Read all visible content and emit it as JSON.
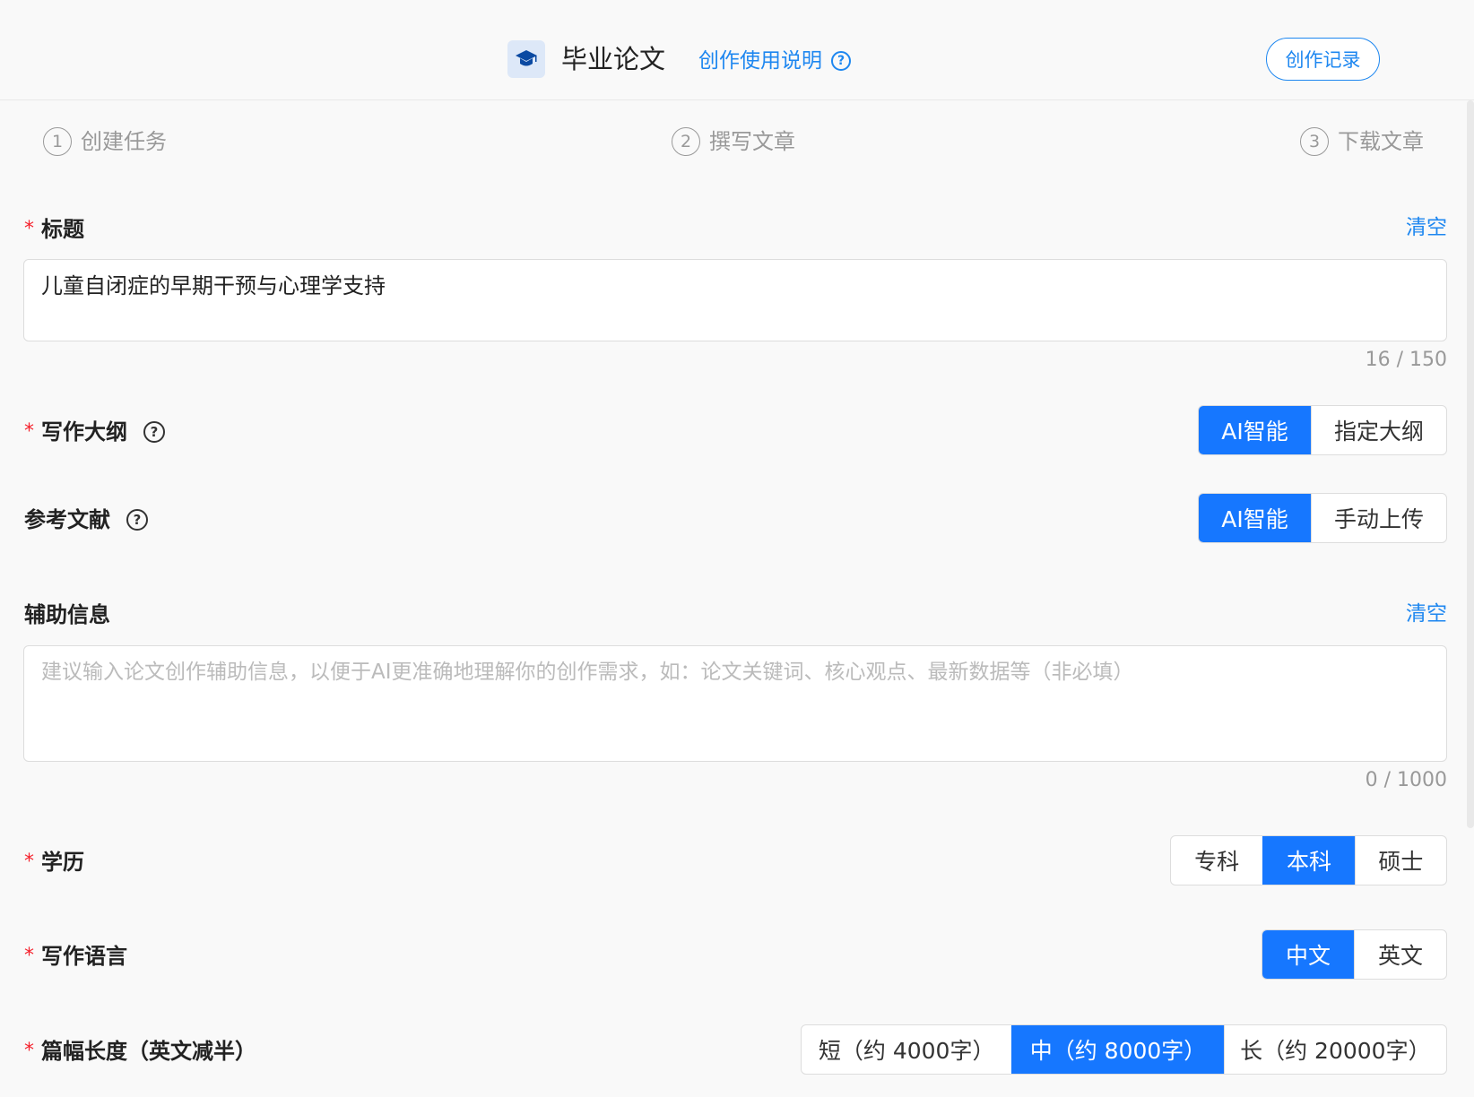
{
  "header": {
    "title": "毕业论文",
    "help_link": "创作使用说明",
    "record_button": "创作记录"
  },
  "steps": [
    {
      "num": "1",
      "label": "创建任务"
    },
    {
      "num": "2",
      "label": "撰写文章"
    },
    {
      "num": "3",
      "label": "下载文章"
    }
  ],
  "form": {
    "title_field": {
      "label": "标题",
      "clear": "清空",
      "value": "儿童自闭症的早期干预与心理学支持",
      "counter": "16 / 150"
    },
    "outline": {
      "label": "写作大纲",
      "options": [
        "AI智能",
        "指定大纲"
      ],
      "selected": "AI智能"
    },
    "references": {
      "label": "参考文献",
      "options": [
        "AI智能",
        "手动上传"
      ],
      "selected": "AI智能"
    },
    "aux_info": {
      "label": "辅助信息",
      "clear": "清空",
      "placeholder": "建议输入论文创作辅助信息，以便于AI更准确地理解你的创作需求，如：论文关键词、核心观点、最新数据等（非必填）",
      "value": "",
      "counter": "0 / 1000"
    },
    "education": {
      "label": "学历",
      "options": [
        "专科",
        "本科",
        "硕士"
      ],
      "selected": "本科"
    },
    "language": {
      "label": "写作语言",
      "options": [
        "中文",
        "英文"
      ],
      "selected": "中文"
    },
    "length": {
      "label": "篇幅长度（英文减半）",
      "options": [
        "短（约 4000字）",
        "中（约 8000字）",
        "长（约 20000字）"
      ],
      "selected": "中（约 8000字）"
    },
    "required_mark": "*",
    "help_glyph": "?"
  },
  "colors": {
    "accent": "#1e87f0",
    "active": "#1677ff",
    "required": "#f5222d"
  }
}
